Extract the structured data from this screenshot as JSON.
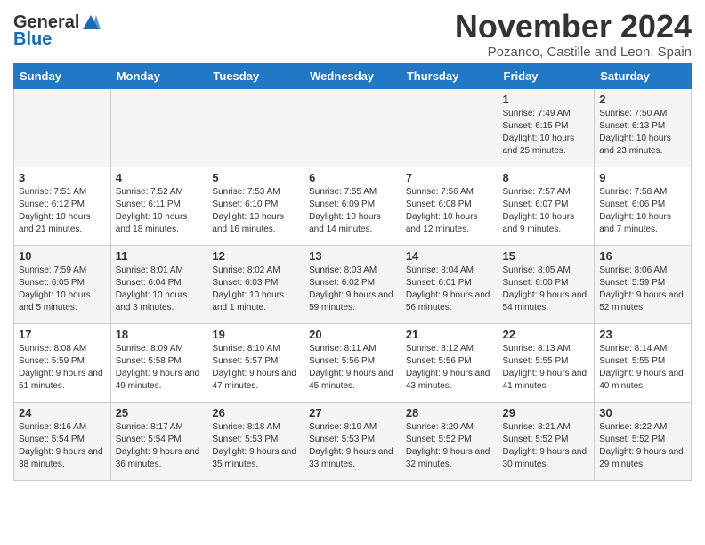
{
  "header": {
    "logo_line1": "General",
    "logo_line2": "Blue",
    "month_title": "November 2024",
    "location": "Pozanco, Castille and Leon, Spain"
  },
  "days_of_week": [
    "Sunday",
    "Monday",
    "Tuesday",
    "Wednesday",
    "Thursday",
    "Friday",
    "Saturday"
  ],
  "weeks": [
    [
      {
        "day": "",
        "info": ""
      },
      {
        "day": "",
        "info": ""
      },
      {
        "day": "",
        "info": ""
      },
      {
        "day": "",
        "info": ""
      },
      {
        "day": "",
        "info": ""
      },
      {
        "day": "1",
        "info": "Sunrise: 7:49 AM\nSunset: 6:15 PM\nDaylight: 10 hours and 25 minutes."
      },
      {
        "day": "2",
        "info": "Sunrise: 7:50 AM\nSunset: 6:13 PM\nDaylight: 10 hours and 23 minutes."
      }
    ],
    [
      {
        "day": "3",
        "info": "Sunrise: 7:51 AM\nSunset: 6:12 PM\nDaylight: 10 hours and 21 minutes."
      },
      {
        "day": "4",
        "info": "Sunrise: 7:52 AM\nSunset: 6:11 PM\nDaylight: 10 hours and 18 minutes."
      },
      {
        "day": "5",
        "info": "Sunrise: 7:53 AM\nSunset: 6:10 PM\nDaylight: 10 hours and 16 minutes."
      },
      {
        "day": "6",
        "info": "Sunrise: 7:55 AM\nSunset: 6:09 PM\nDaylight: 10 hours and 14 minutes."
      },
      {
        "day": "7",
        "info": "Sunrise: 7:56 AM\nSunset: 6:08 PM\nDaylight: 10 hours and 12 minutes."
      },
      {
        "day": "8",
        "info": "Sunrise: 7:57 AM\nSunset: 6:07 PM\nDaylight: 10 hours and 9 minutes."
      },
      {
        "day": "9",
        "info": "Sunrise: 7:58 AM\nSunset: 6:06 PM\nDaylight: 10 hours and 7 minutes."
      }
    ],
    [
      {
        "day": "10",
        "info": "Sunrise: 7:59 AM\nSunset: 6:05 PM\nDaylight: 10 hours and 5 minutes."
      },
      {
        "day": "11",
        "info": "Sunrise: 8:01 AM\nSunset: 6:04 PM\nDaylight: 10 hours and 3 minutes."
      },
      {
        "day": "12",
        "info": "Sunrise: 8:02 AM\nSunset: 6:03 PM\nDaylight: 10 hours and 1 minute."
      },
      {
        "day": "13",
        "info": "Sunrise: 8:03 AM\nSunset: 6:02 PM\nDaylight: 9 hours and 59 minutes."
      },
      {
        "day": "14",
        "info": "Sunrise: 8:04 AM\nSunset: 6:01 PM\nDaylight: 9 hours and 56 minutes."
      },
      {
        "day": "15",
        "info": "Sunrise: 8:05 AM\nSunset: 6:00 PM\nDaylight: 9 hours and 54 minutes."
      },
      {
        "day": "16",
        "info": "Sunrise: 8:06 AM\nSunset: 5:59 PM\nDaylight: 9 hours and 52 minutes."
      }
    ],
    [
      {
        "day": "17",
        "info": "Sunrise: 8:08 AM\nSunset: 5:59 PM\nDaylight: 9 hours and 51 minutes."
      },
      {
        "day": "18",
        "info": "Sunrise: 8:09 AM\nSunset: 5:58 PM\nDaylight: 9 hours and 49 minutes."
      },
      {
        "day": "19",
        "info": "Sunrise: 8:10 AM\nSunset: 5:57 PM\nDaylight: 9 hours and 47 minutes."
      },
      {
        "day": "20",
        "info": "Sunrise: 8:11 AM\nSunset: 5:56 PM\nDaylight: 9 hours and 45 minutes."
      },
      {
        "day": "21",
        "info": "Sunrise: 8:12 AM\nSunset: 5:56 PM\nDaylight: 9 hours and 43 minutes."
      },
      {
        "day": "22",
        "info": "Sunrise: 8:13 AM\nSunset: 5:55 PM\nDaylight: 9 hours and 41 minutes."
      },
      {
        "day": "23",
        "info": "Sunrise: 8:14 AM\nSunset: 5:55 PM\nDaylight: 9 hours and 40 minutes."
      }
    ],
    [
      {
        "day": "24",
        "info": "Sunrise: 8:16 AM\nSunset: 5:54 PM\nDaylight: 9 hours and 38 minutes."
      },
      {
        "day": "25",
        "info": "Sunrise: 8:17 AM\nSunset: 5:54 PM\nDaylight: 9 hours and 36 minutes."
      },
      {
        "day": "26",
        "info": "Sunrise: 8:18 AM\nSunset: 5:53 PM\nDaylight: 9 hours and 35 minutes."
      },
      {
        "day": "27",
        "info": "Sunrise: 8:19 AM\nSunset: 5:53 PM\nDaylight: 9 hours and 33 minutes."
      },
      {
        "day": "28",
        "info": "Sunrise: 8:20 AM\nSunset: 5:52 PM\nDaylight: 9 hours and 32 minutes."
      },
      {
        "day": "29",
        "info": "Sunrise: 8:21 AM\nSunset: 5:52 PM\nDaylight: 9 hours and 30 minutes."
      },
      {
        "day": "30",
        "info": "Sunrise: 8:22 AM\nSunset: 5:52 PM\nDaylight: 9 hours and 29 minutes."
      }
    ]
  ]
}
